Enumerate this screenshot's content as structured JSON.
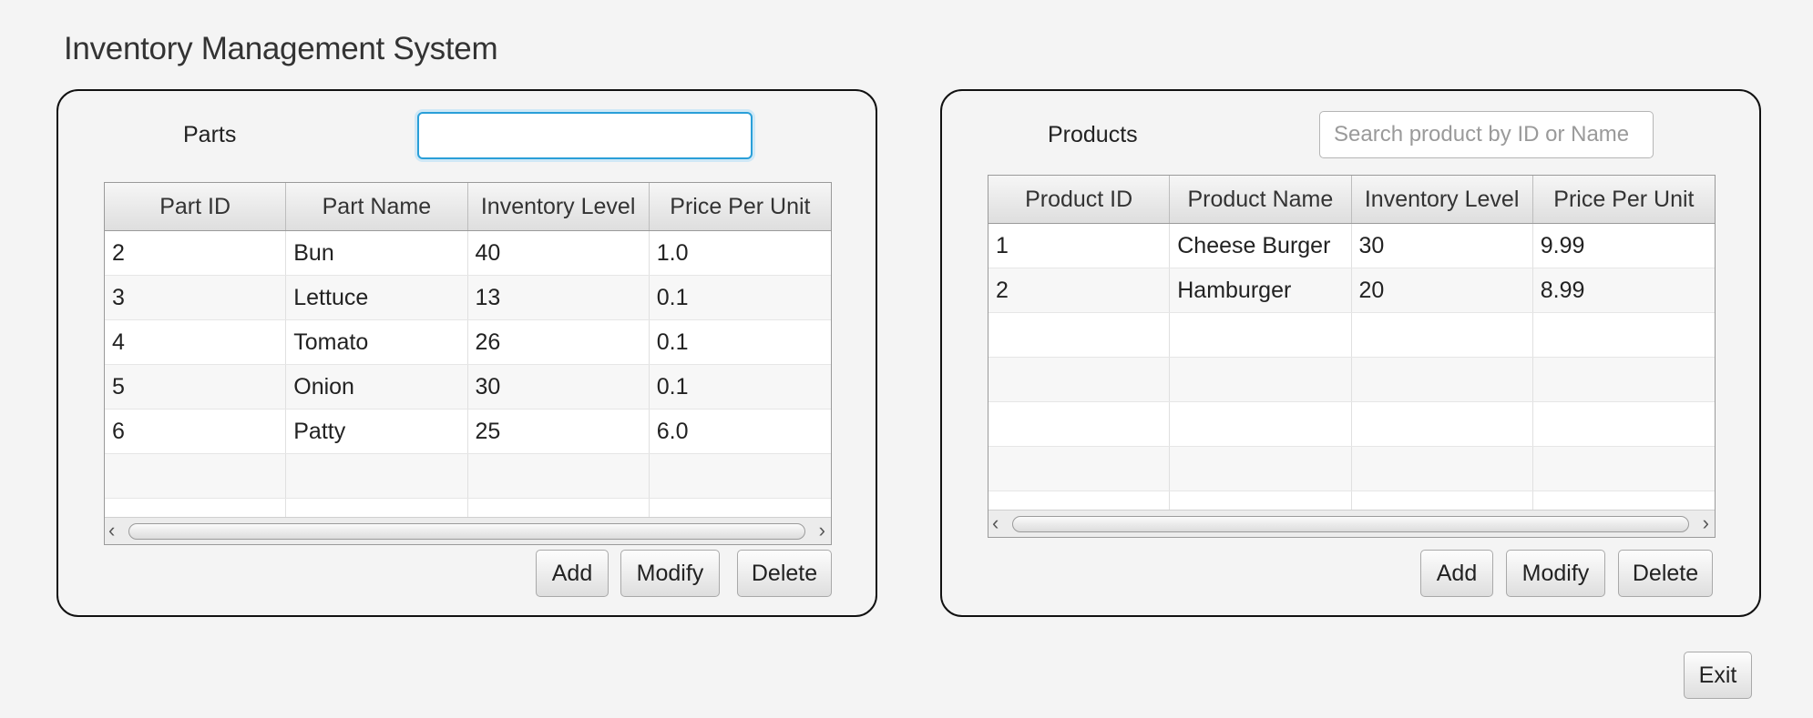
{
  "app": {
    "title": "Inventory Management System"
  },
  "parts": {
    "label": "Parts",
    "search": {
      "value": "",
      "placeholder": ""
    },
    "columns": [
      "Part ID",
      "Part Name",
      "Inventory Level",
      "Price Per Unit"
    ],
    "rows": [
      [
        "2",
        "Bun",
        "40",
        "1.0"
      ],
      [
        "3",
        "Lettuce",
        "13",
        "0.1"
      ],
      [
        "4",
        "Tomato",
        "26",
        "0.1"
      ],
      [
        "5",
        "Onion",
        "30",
        "0.1"
      ],
      [
        "6",
        "Patty",
        "25",
        "6.0"
      ]
    ],
    "buttons": {
      "add": "Add",
      "modify": "Modify",
      "delete": "Delete"
    }
  },
  "products": {
    "label": "Products",
    "search": {
      "value": "",
      "placeholder": "Search product by ID or Name"
    },
    "columns": [
      "Product ID",
      "Product Name",
      "Inventory Level",
      "Price Per Unit"
    ],
    "rows": [
      [
        "1",
        "Cheese Burger",
        "30",
        "9.99"
      ],
      [
        "2",
        "Hamburger",
        "20",
        "8.99"
      ]
    ],
    "buttons": {
      "add": "Add",
      "modify": "Modify",
      "delete": "Delete"
    }
  },
  "footer": {
    "exit_label": "Exit"
  },
  "icons": {
    "scroll_left": "chevron-left-icon",
    "scroll_right": "chevron-right-icon"
  },
  "colors": {
    "focus_accent": "#2a9fd8",
    "panel_border": "#111111",
    "background": "#f4f4f4"
  }
}
